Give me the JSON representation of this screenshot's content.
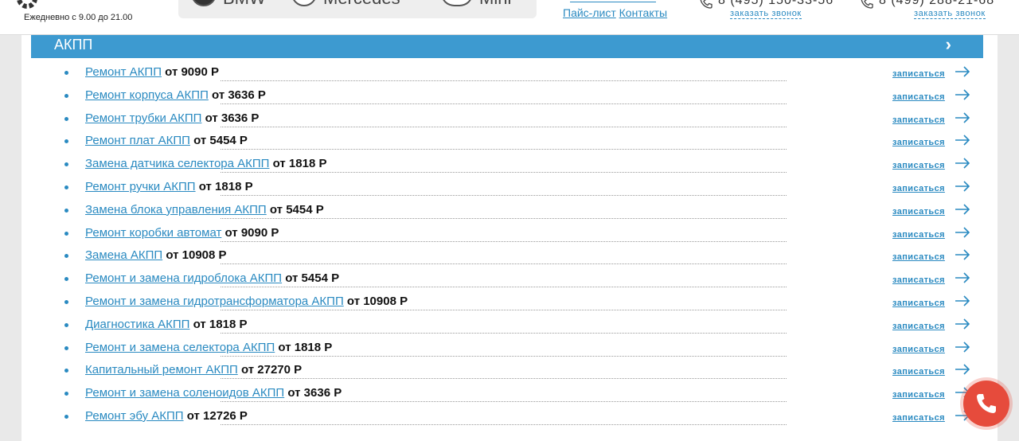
{
  "header": {
    "hours": "Ежедневно с 9.00 до 21.00",
    "brands": [
      "BMW",
      "Mercedes",
      "Mini"
    ],
    "nav_links": [
      "Пайс-лист",
      "Контакты"
    ],
    "phones": [
      {
        "number": "8 (495) 150-33-56",
        "callback_label": "заказать звонок"
      },
      {
        "number": "8 (499) 288-21-68",
        "callback_label": "заказать звонок"
      }
    ]
  },
  "section": {
    "title": "АКПП",
    "chevron": "›"
  },
  "book_label": "записаться",
  "services": [
    {
      "name": "Ремонт АКПП",
      "price": "от 9090 Р"
    },
    {
      "name": "Ремонт корпуса АКПП",
      "price": "от 3636 Р"
    },
    {
      "name": "Ремонт трубки АКПП",
      "price": "от 3636 Р"
    },
    {
      "name": "Ремонт плат АКПП",
      "price": "от 5454 Р"
    },
    {
      "name": "Замена датчика селектора АКПП",
      "price": "от 1818 Р"
    },
    {
      "name": "Ремонт ручки АКПП",
      "price": "от 1818 Р"
    },
    {
      "name": "Замена блока управления АКПП",
      "price": "от 5454 Р"
    },
    {
      "name": "Ремонт коробки автомат",
      "price": "от 9090 Р"
    },
    {
      "name": "Замена АКПП",
      "price": "от 10908 Р"
    },
    {
      "name": "Ремонт и замена гидроблока АКПП",
      "price": "от 5454 Р"
    },
    {
      "name": "Ремонт и замена гидротрансформатора АКПП",
      "price": "от 10908 Р"
    },
    {
      "name": "Диагностика АКПП",
      "price": "от 1818 Р"
    },
    {
      "name": "Ремонт и замена селектора АКПП",
      "price": "от 1818 Р"
    },
    {
      "name": "Капитальный ремонт АКПП",
      "price": "от 27270 Р"
    },
    {
      "name": "Ремонт и замена соленоидов АКПП",
      "price": "от 3636 Р"
    },
    {
      "name": "Ремонт эбу АКПП",
      "price": "от 12726 Р"
    }
  ],
  "colors": {
    "accent": "#3d9ad0",
    "link": "#2a8ac1",
    "call_button": "#e64b3c"
  },
  "icons": {
    "logo": "gear-logo-icon",
    "phone": "phone-icon",
    "arrow": "arrow-right-icon",
    "fab": "phone-call-icon"
  }
}
